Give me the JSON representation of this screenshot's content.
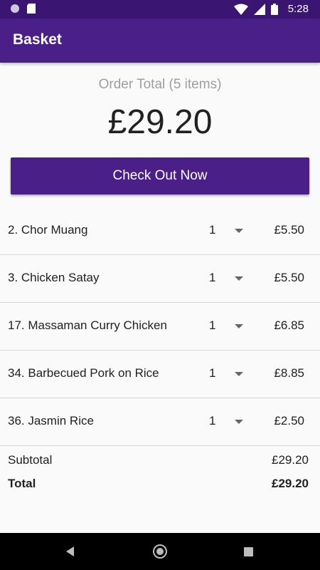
{
  "status_bar": {
    "time": "5:28",
    "icons": [
      "notification-dot-icon",
      "sd-card-icon",
      "wifi-icon",
      "signal-icon",
      "battery-icon"
    ]
  },
  "app_bar": {
    "title": "Basket"
  },
  "order": {
    "caption": "Order Total (5 items)",
    "total": "£29.20",
    "checkout_label": "Check Out Now"
  },
  "items": [
    {
      "name": "2. Chor Muang",
      "qty": "1",
      "price": "£5.50"
    },
    {
      "name": "3. Chicken Satay",
      "qty": "1",
      "price": "£5.50"
    },
    {
      "name": "17. Massaman Curry Chicken",
      "qty": "1",
      "price": "£6.85"
    },
    {
      "name": "34. Barbecued Pork on Rice",
      "qty": "1",
      "price": "£8.85"
    },
    {
      "name": "36. Jasmin Rice",
      "qty": "1",
      "price": "£2.50"
    }
  ],
  "summary": {
    "subtotal_label": "Subtotal",
    "subtotal_value": "£29.20",
    "total_label": "Total",
    "total_value": "£29.20"
  },
  "colors": {
    "primary": "#4b1f88",
    "primary_dark": "#3a1571"
  }
}
